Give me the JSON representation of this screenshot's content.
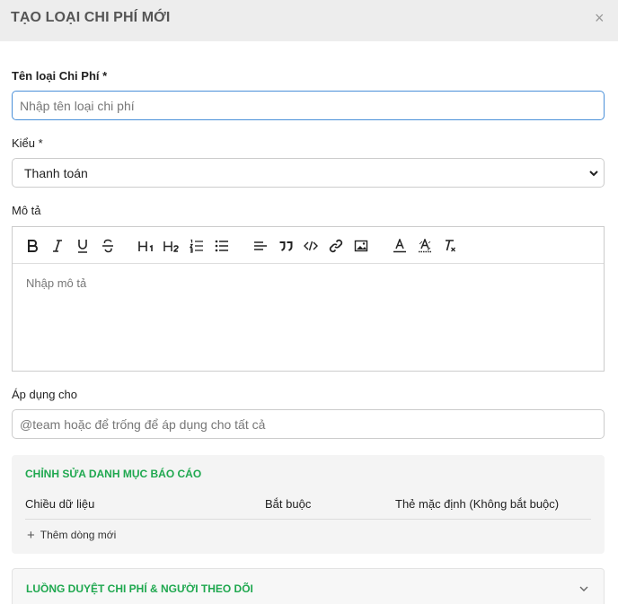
{
  "dialog": {
    "title": "TẠO LOẠI CHI PHÍ MỚI",
    "close": "×"
  },
  "name_field": {
    "label": "Tên loại Chi Phí *",
    "placeholder": "Nhập tên loại chi phí",
    "value": ""
  },
  "type_field": {
    "label": "Kiểu *",
    "value": "Thanh toán"
  },
  "description": {
    "label": "Mô tả",
    "placeholder": "Nhập mô tả",
    "toolbar": [
      "bold-icon",
      "italic-icon",
      "underline-icon",
      "strikethrough-icon",
      "heading-1-icon",
      "heading-2-icon",
      "ordered-list-icon",
      "bullet-list-icon",
      "align-left-icon",
      "quote-icon",
      "code-icon",
      "link-icon",
      "image-icon",
      "text-color-icon",
      "highlight-icon",
      "clear-format-icon"
    ]
  },
  "apply_to": {
    "label": "Áp dụng cho",
    "placeholder": "@team hoặc để trống để áp dụng cho tất cả"
  },
  "report_section": {
    "title": "CHỈNH SỬA DANH MỤC BÁO CÁO",
    "columns": [
      "Chiều dữ liệu",
      "Bắt buộc",
      "Thẻ mặc định (Không bắt buộc)"
    ],
    "add_row": "Thêm dòng mới"
  },
  "approval_section": {
    "title": "LUỒNG DUYỆT CHI PHÍ & NGƯỜI THEO DÕI"
  },
  "colors": {
    "accent_green": "#1fa84f",
    "focus_blue": "#4a90d9",
    "header_bg": "#ededed"
  }
}
